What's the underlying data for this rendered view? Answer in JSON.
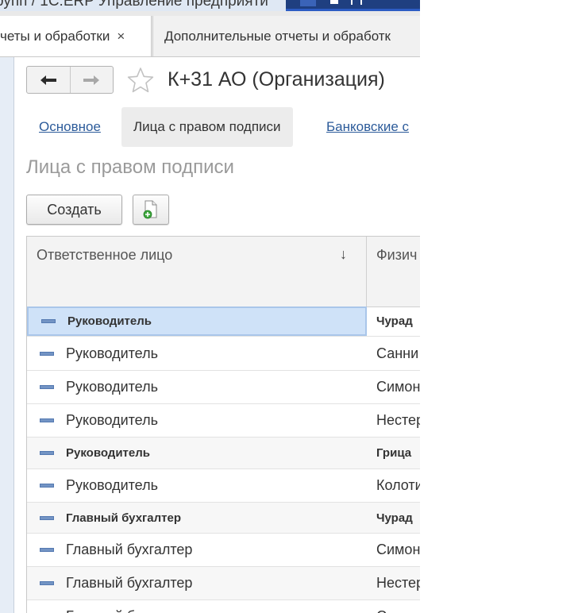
{
  "window": {
    "title": "рупп / 1С:ERP Управление предприяти"
  },
  "tabs": [
    {
      "label": "четы и обработки",
      "close": "×"
    },
    {
      "label": "Дополнительные отчеты и обработк"
    }
  ],
  "header": {
    "title": "К+31 АО (Организация)"
  },
  "section_tabs": [
    {
      "label": "Основное"
    },
    {
      "label": "Лица с правом подписи"
    },
    {
      "label": "Банковские с"
    }
  ],
  "section": {
    "subtitle": "Лица с правом подписи"
  },
  "toolbar": {
    "create_label": "Создать"
  },
  "table": {
    "columns": [
      "Ответственное лицо",
      "Физич"
    ],
    "sort_indicator": "↓",
    "rows": [
      {
        "role": "Руководитель",
        "person": "Чурад"
      },
      {
        "role": "Руководитель",
        "person": "Санни"
      },
      {
        "role": "Руководитель",
        "person": "Симон"
      },
      {
        "role": "Руководитель",
        "person": "Нестер"
      },
      {
        "role": "Руководитель",
        "person": "Грица"
      },
      {
        "role": "Руководитель",
        "person": "Колоти"
      },
      {
        "role": "Главный бухгалтер",
        "person": "Чурад"
      },
      {
        "role": "Главный бухгалтер",
        "person": "Симон"
      },
      {
        "role": "Главный бухгалтер",
        "person": "Нестер"
      },
      {
        "role": "Главный бухгалтер",
        "person": "Санни"
      }
    ]
  },
  "colors": {
    "link": "#2c5b9a",
    "selection": "#cfe2f8",
    "row_marker": "#7394c4",
    "titlebar_accent": "#1f3f80"
  },
  "icons": [
    "arrow-left-icon",
    "arrow-right-icon",
    "star-icon",
    "copy-document-icon",
    "row-marker-icon",
    "sort-down-icon",
    "close-icon"
  ]
}
